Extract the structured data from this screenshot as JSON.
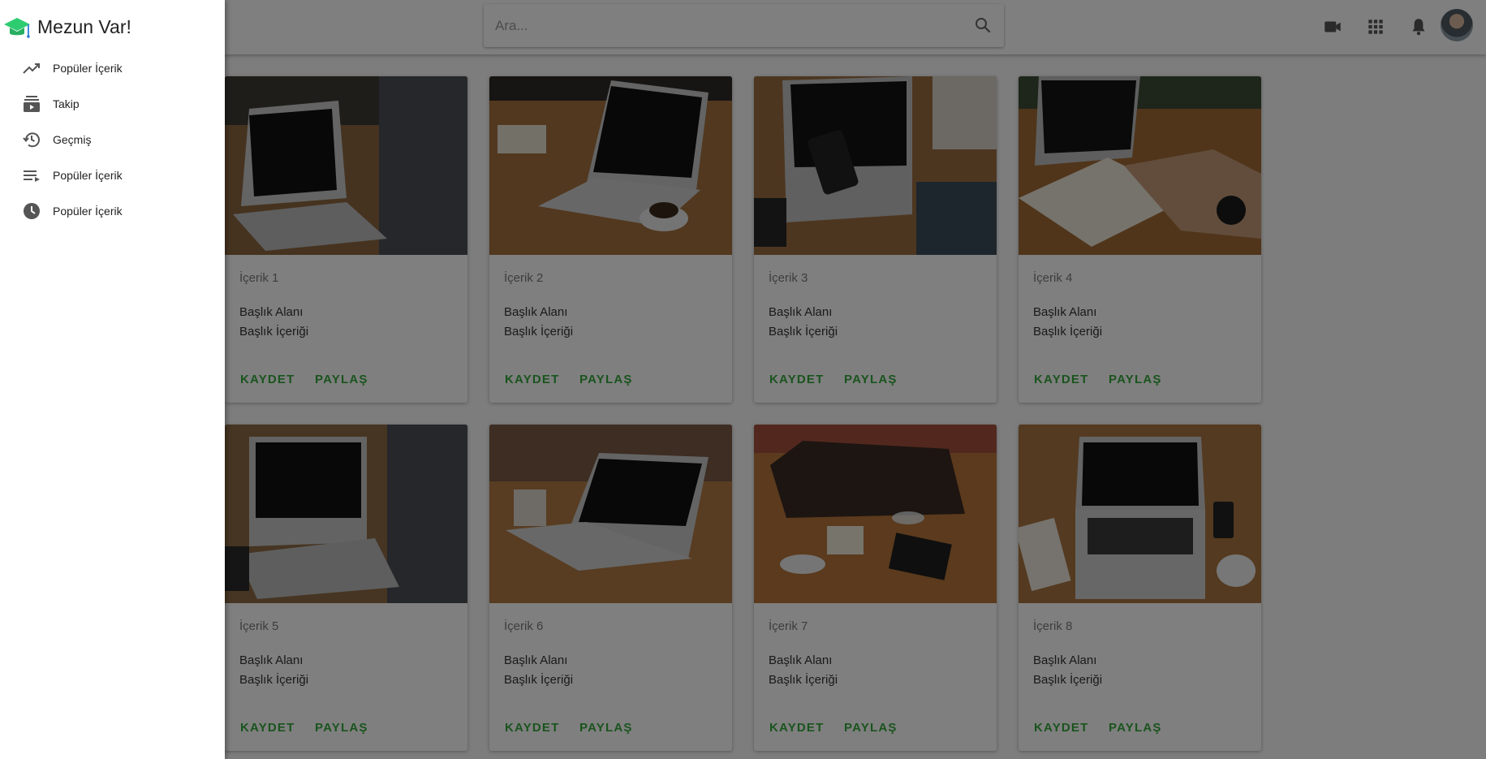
{
  "app": {
    "title": "Mezun Var!",
    "brand_color": "#2ecc71"
  },
  "search": {
    "placeholder": "Ara..."
  },
  "toolbar": {
    "icons": [
      "video-icon",
      "apps-grid-icon",
      "notifications-bell-icon"
    ],
    "avatar": "user-avatar"
  },
  "drawer": {
    "items": [
      {
        "label": "Popüler İçerik",
        "icon": "trending-up-icon"
      },
      {
        "label": "Takip",
        "icon": "subscriptions-icon"
      },
      {
        "label": "Geçmiş",
        "icon": "history-icon"
      },
      {
        "label": "Popüler İçerik",
        "icon": "playlist-icon"
      },
      {
        "label": "Popüler İçerik",
        "icon": "clock-icon"
      }
    ]
  },
  "cards": [
    {
      "subtitle": "İçerik 1",
      "title": "Başlık Alanı",
      "description": "Başlık İçeriği",
      "save_label": "KAYDET",
      "share_label": "PAYLAŞ"
    },
    {
      "subtitle": "İçerik 2",
      "title": "Başlık Alanı",
      "description": "Başlık İçeriği",
      "save_label": "KAYDET",
      "share_label": "PAYLAŞ"
    },
    {
      "subtitle": "İçerik 3",
      "title": "Başlık Alanı",
      "description": "Başlık İçeriği",
      "save_label": "KAYDET",
      "share_label": "PAYLAŞ"
    },
    {
      "subtitle": "İçerik 4",
      "title": "Başlık Alanı",
      "description": "Başlık İçeriği",
      "save_label": "KAYDET",
      "share_label": "PAYLAŞ"
    },
    {
      "subtitle": "İçerik 5",
      "title": "Başlık Alanı",
      "description": "Başlık İçeriği",
      "save_label": "KAYDET",
      "share_label": "PAYLAŞ"
    },
    {
      "subtitle": "İçerik 6",
      "title": "Başlık Alanı",
      "description": "Başlık İçeriği",
      "save_label": "KAYDET",
      "share_label": "PAYLAŞ"
    },
    {
      "subtitle": "İçerik 7",
      "title": "Başlık Alanı",
      "description": "Başlık İçeriği",
      "save_label": "KAYDET",
      "share_label": "PAYLAŞ"
    },
    {
      "subtitle": "İçerik 8",
      "title": "Başlık Alanı",
      "description": "Başlık İçeriği",
      "save_label": "KAYDET",
      "share_label": "PAYLAŞ"
    }
  ],
  "colors": {
    "accent": "#34a83c",
    "scrim": "rgba(0,0,0,0.5)"
  }
}
